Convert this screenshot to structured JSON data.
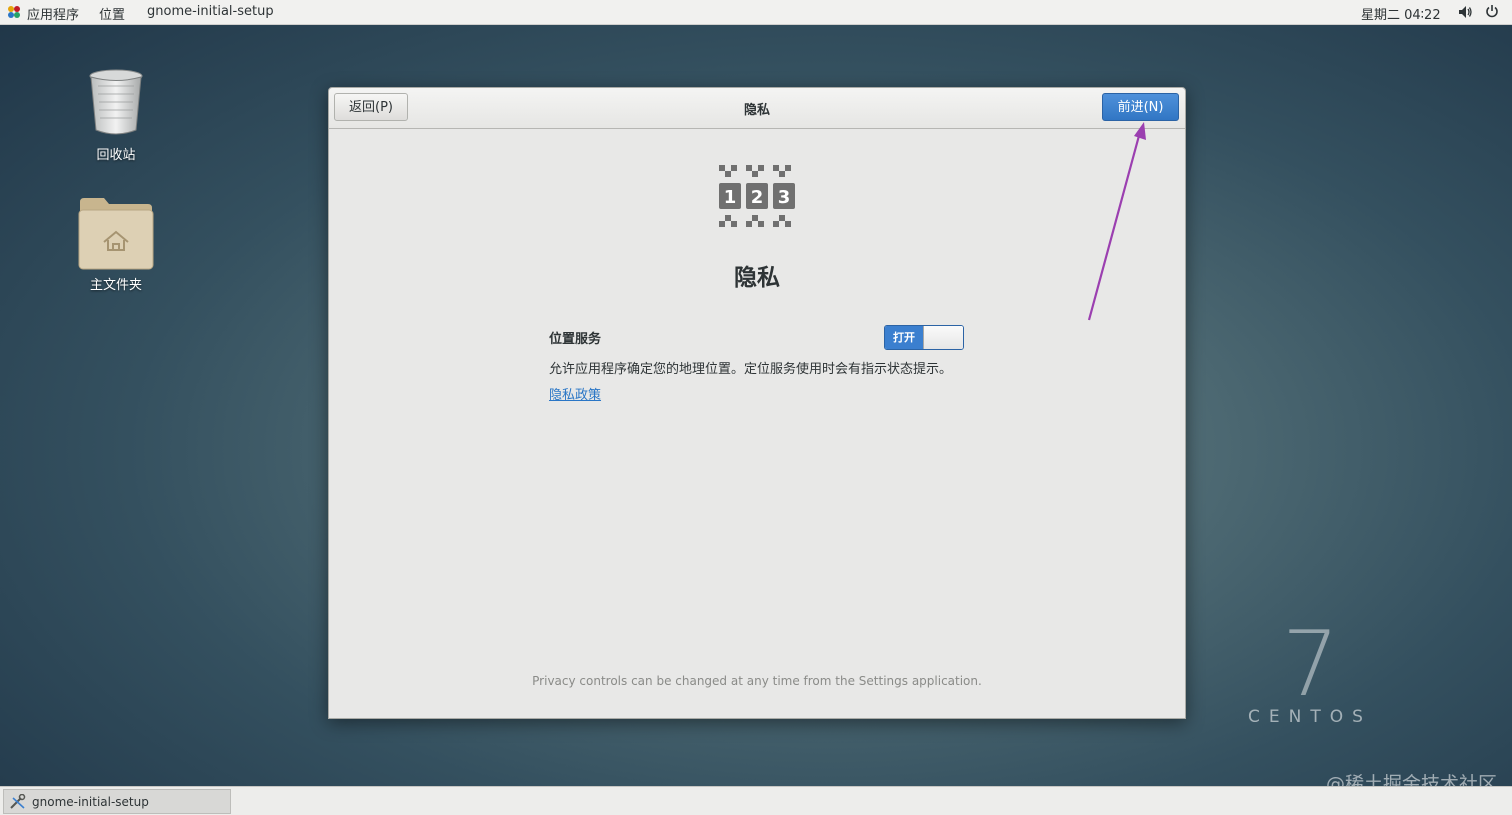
{
  "topbar": {
    "apps_label": "应用程序",
    "places_label": "位置",
    "app_name": "gnome-initial-setup",
    "clock": "星期二 04∶22",
    "volume_icon": "volume-icon",
    "power_icon": "power-icon"
  },
  "desktop": {
    "icons": [
      {
        "label": "回收站",
        "icon": "trash-icon"
      },
      {
        "label": "主文件夹",
        "icon": "home-folder-icon"
      }
    ]
  },
  "dialog": {
    "title": "隐私",
    "back_label": "返回(P)",
    "next_label": "前进(N)",
    "heading": "隐私",
    "location_label": "位置服务",
    "toggle_on_label": "打开",
    "location_state": "on",
    "location_description": "允许应用程序确定您的地理位置。定位服务使用时会有指示状态提示。",
    "policy_link": "隐私政策",
    "footer_note": "Privacy controls can be changed at any time from the Settings application.",
    "privacy_icon_digits": [
      "1",
      "2",
      "3"
    ]
  },
  "taskbar": {
    "items": [
      {
        "label": "gnome-initial-setup",
        "icon": "setup-tool-icon"
      }
    ]
  },
  "branding": {
    "version": "7",
    "wordmark": "CENTOS",
    "watermark": "@稀土掘金技术社区"
  },
  "colors": {
    "accent": "#3b7fcf",
    "annotation_arrow": "#9b3fb0"
  }
}
